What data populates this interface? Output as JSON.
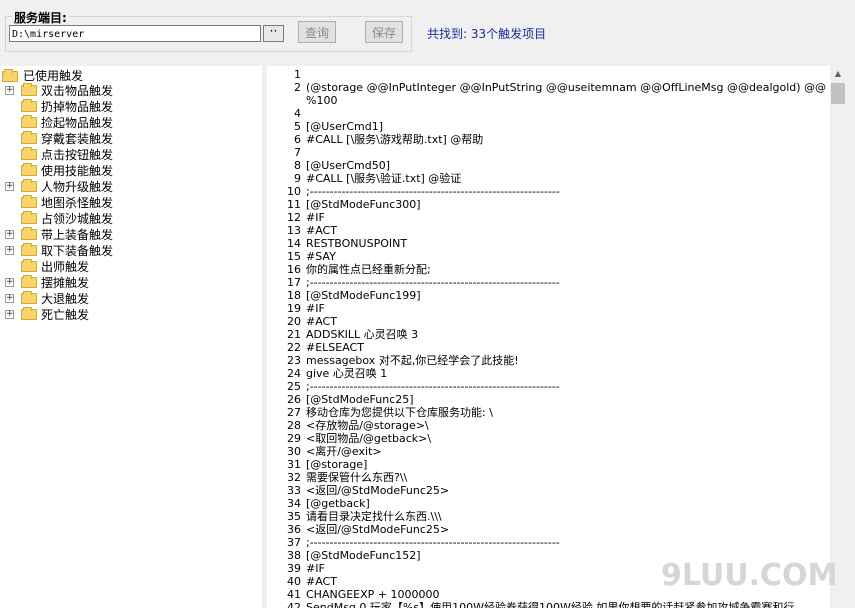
{
  "toolbar": {
    "group_title": "服务端目:",
    "path_value": "D:\\mirserver",
    "browse_label": "··",
    "query_label": "查询",
    "save_label": "保存",
    "found_text": "共找到: 33个触发项目"
  },
  "tree": {
    "root_label": "已使用触发",
    "items": [
      {
        "label": "双击物品触发",
        "expandable": true
      },
      {
        "label": "扔掉物品触发",
        "expandable": false
      },
      {
        "label": "捡起物品触发",
        "expandable": false
      },
      {
        "label": "穿戴套装触发",
        "expandable": false
      },
      {
        "label": "点击按钮触发",
        "expandable": false
      },
      {
        "label": "使用技能触发",
        "expandable": false
      },
      {
        "label": "人物升级触发",
        "expandable": true
      },
      {
        "label": "地图杀怪触发",
        "expandable": false
      },
      {
        "label": "占领沙城触发",
        "expandable": false
      },
      {
        "label": "带上装备触发",
        "expandable": true
      },
      {
        "label": "取下装备触发",
        "expandable": true
      },
      {
        "label": "出师触发",
        "expandable": false
      },
      {
        "label": "摆摊触发",
        "expandable": true
      },
      {
        "label": "大退触发",
        "expandable": true
      },
      {
        "label": "死亡触发",
        "expandable": true
      }
    ]
  },
  "editor": {
    "lines": [
      {
        "n": "1",
        "t": ""
      },
      {
        "n": "2",
        "t": "(@storage @@InPutInteger @@InPutString @@useitemnam @@OffLineMsg @@dealgold) @@"
      },
      {
        "n": "",
        "t": "%100"
      },
      {
        "n": "4",
        "t": ""
      },
      {
        "n": "5",
        "t": "[@UserCmd1]"
      },
      {
        "n": "6",
        "t": "#CALL [\\服务\\游戏帮助.txt] @帮助"
      },
      {
        "n": "7",
        "t": ""
      },
      {
        "n": "8",
        "t": "[@UserCmd50]"
      },
      {
        "n": "9",
        "t": "#CALL [\\服务\\验证.txt] @验证"
      },
      {
        "n": "10",
        "t": ";---------------------------------------------------------------"
      },
      {
        "n": "11",
        "t": "[@StdModeFunc300]"
      },
      {
        "n": "12",
        "t": "#IF"
      },
      {
        "n": "13",
        "t": "#ACT"
      },
      {
        "n": "14",
        "t": "RESTBONUSPOINT"
      },
      {
        "n": "15",
        "t": "#SAY"
      },
      {
        "n": "16",
        "t": "你的属性点已经重新分配;"
      },
      {
        "n": "17",
        "t": ";---------------------------------------------------------------"
      },
      {
        "n": "18",
        "t": "[@StdModeFunc199]"
      },
      {
        "n": "19",
        "t": "#IF"
      },
      {
        "n": "20",
        "t": "#ACT"
      },
      {
        "n": "21",
        "t": "ADDSKILL 心灵召唤 3"
      },
      {
        "n": "22",
        "t": "#ELSEACT"
      },
      {
        "n": "23",
        "t": "messagebox  对不起,你已经学会了此技能!"
      },
      {
        "n": "24",
        "t": "give 心灵召唤 1"
      },
      {
        "n": "25",
        "t": ";---------------------------------------------------------------"
      },
      {
        "n": "26",
        "t": "[@StdModeFunc25]"
      },
      {
        "n": "27",
        "t": "移动仓库为您提供以下仓库服务功能: \\"
      },
      {
        "n": "28",
        "t": "<存放物品/@storage>\\"
      },
      {
        "n": "29",
        "t": "<取回物品/@getback>\\"
      },
      {
        "n": "30",
        "t": "<离开/@exit>"
      },
      {
        "n": "31",
        "t": "[@storage]"
      },
      {
        "n": "32",
        "t": "需要保管什么东西?\\\\"
      },
      {
        "n": "33",
        "t": "<返回/@StdModeFunc25>"
      },
      {
        "n": "34",
        "t": "[@getback]"
      },
      {
        "n": "35",
        "t": "请看目录决定找什么东西.\\\\\\"
      },
      {
        "n": "36",
        "t": "<返回/@StdModeFunc25>"
      },
      {
        "n": "37",
        "t": ";---------------------------------------------------------------"
      },
      {
        "n": "38",
        "t": "[@StdModeFunc152]"
      },
      {
        "n": "39",
        "t": "#IF"
      },
      {
        "n": "40",
        "t": "#ACT"
      },
      {
        "n": "41",
        "t": "CHANGEEXP + 1000000"
      },
      {
        "n": "42",
        "t": "SendMsg 0 玩家【%s】使用100W经验卷获得100W经验,如果你想要的话赶紧参加攻城争霸赛和行"
      }
    ]
  },
  "watermark": "9LUU.COM"
}
